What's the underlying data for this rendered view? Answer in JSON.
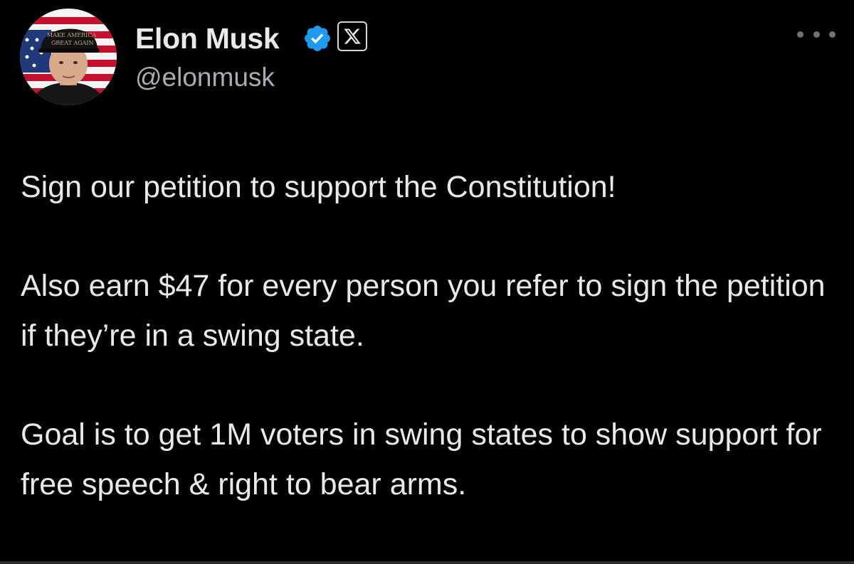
{
  "author": {
    "display_name": "Elon Musk",
    "handle": "@elonmusk",
    "verified": true,
    "affiliate_badge": "X",
    "avatar": {
      "description_icon": "profile-photo",
      "hat_text_line1": "MAKE AMERICA",
      "hat_text_line2": "GREAT AGAIN"
    }
  },
  "menu": {
    "icon": "more-horizontal-icon"
  },
  "tweet": {
    "paragraphs": [
      "Sign our petition to support the Constitution!",
      "Also earn $47 for every person you refer to sign the petition if they’re in a swing state.",
      "Goal is to get 1M voters in swing states to show support for free speech & right to bear arms."
    ]
  },
  "colors": {
    "background": "#000000",
    "text_primary": "#e7e9ea",
    "text_secondary": "#a9adb1",
    "verified_blue": "#1d9bf0"
  }
}
